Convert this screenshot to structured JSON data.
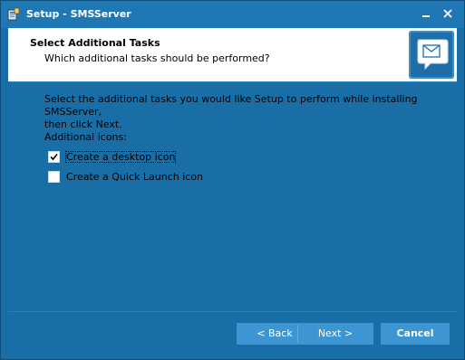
{
  "window": {
    "title": "Setup - SMSServer"
  },
  "header": {
    "title": "Select Additional Tasks",
    "subtitle": "Which additional tasks should be performed?"
  },
  "content": {
    "intro_line1": "Select the additional tasks you would like Setup to perform while installing SMSServer,",
    "intro_line2": "then click Next.",
    "group_label": "Additional icons:",
    "tasks": [
      {
        "label": "Create a desktop icon",
        "checked": true
      },
      {
        "label": "Create a Quick Launch icon",
        "checked": false
      }
    ]
  },
  "footer": {
    "back_label": "< Back",
    "next_label": "Next >",
    "cancel_label": "Cancel"
  },
  "icons": {
    "app": "setup-app-icon",
    "logo": "envelope-chat-icon",
    "minimize": "minimize-icon",
    "close": "close-icon",
    "check": "checkmark-icon"
  },
  "colors": {
    "background": "#1a6ea6",
    "titlebar": "#1f78b4",
    "button": "#3d95d1",
    "header": "#ffffff"
  }
}
